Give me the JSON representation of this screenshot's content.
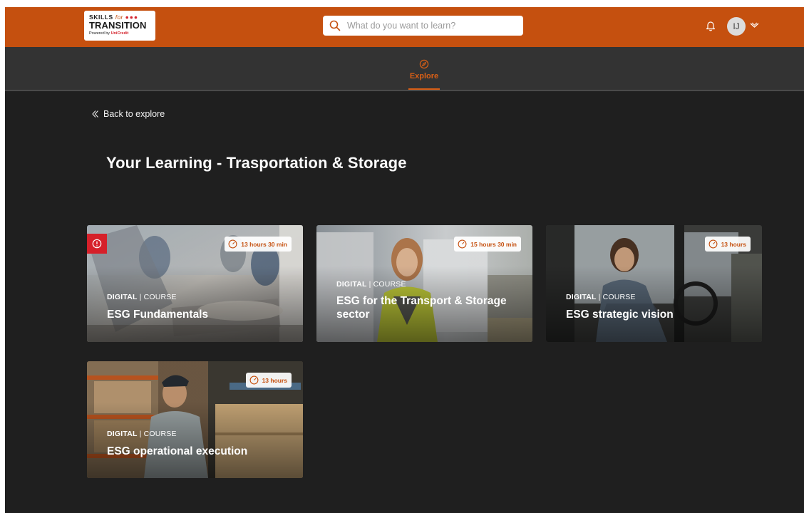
{
  "header": {
    "logo": {
      "line1_skills": "SKILLS",
      "line1_for": "for",
      "line1_dots": "●●●",
      "line2": "TRANSITION",
      "line3_powered": "Powered by",
      "line3_brand": "UniCredit"
    },
    "search": {
      "placeholder": "What do you want to learn?",
      "value": ""
    },
    "avatar_initials": "IJ"
  },
  "subnav": {
    "explore_label": "Explore"
  },
  "back_label": "Back to explore",
  "page_title": "Your Learning - Trasportation & Storage",
  "cards": [
    {
      "duration": "13 hours 30 min",
      "type": "DIGITAL",
      "separator": "|",
      "kind": "COURSE",
      "title": "ESG Fundamentals"
    },
    {
      "duration": "15 hours 30 min",
      "type": "DIGITAL",
      "separator": "|",
      "kind": "COURSE",
      "title": "ESG for the Transport & Storage sector"
    },
    {
      "duration": "13 hours",
      "type": "DIGITAL",
      "separator": "|",
      "kind": "COURSE",
      "title": "ESG strategic vision"
    },
    {
      "duration": "13 hours",
      "type": "DIGITAL",
      "separator": "|",
      "kind": "COURSE",
      "title": "ESG operational execution"
    }
  ],
  "colors": {
    "brand_orange": "#c5500f",
    "accent_orange": "#d95f16",
    "alert_red": "#d6202a",
    "page_bg": "#1f1f1f",
    "subnav_bg": "#333333"
  },
  "icons": {
    "search": "search-icon",
    "bell": "bell-icon",
    "chevron": "chevron-down-icon",
    "explore": "compass-icon",
    "back": "double-chevron-left-icon",
    "duration": "clock-icon",
    "alert": "alert-icon"
  }
}
